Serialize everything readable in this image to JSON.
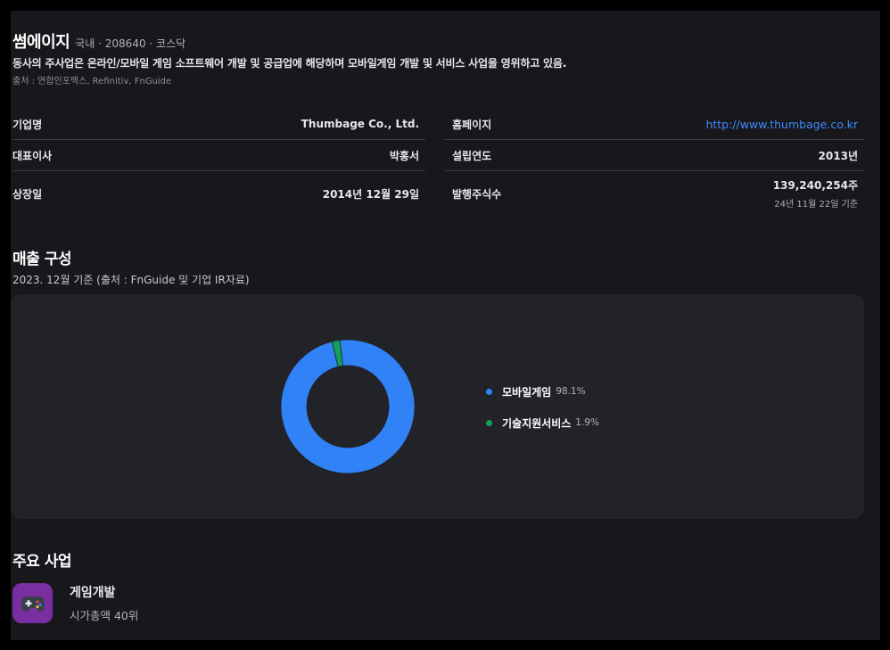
{
  "company": {
    "name": "썸에이지",
    "meta": "국내 · 208640 · 코스닥",
    "description": "동사의 주사업은 온라인/모바일 게임 소프트웨어 개발 및 공급업에 해당하며 모바일게임 개발 및 서비스 사업을 영위하고 있음.",
    "source": "출처 : 연합인포맥스, Refinitiv, FnGuide"
  },
  "info": {
    "left": [
      {
        "label": "기업명",
        "value": "Thumbage Co., Ltd."
      },
      {
        "label": "대표이사",
        "value": "박홍서"
      },
      {
        "label": "상장일",
        "value": "2014년 12월 29일"
      }
    ],
    "right": [
      {
        "label": "홈페이지",
        "value": "http://www.thumbage.co.kr"
      },
      {
        "label": "설립연도",
        "value": "2013년"
      },
      {
        "label": "발행주식수",
        "value": "139,240,254주",
        "sub": "24년 11월 22일 기준"
      }
    ]
  },
  "revenue": {
    "title": "매출 구성",
    "subtitle": "2023. 12월 기준 (출처 : FnGuide 및 기업 IR자료)"
  },
  "chart_data": {
    "type": "pie",
    "categories": [
      "모바일게임",
      "기술지원서비스"
    ],
    "values": [
      98.1,
      1.9
    ],
    "value_labels": [
      "98.1%",
      "1.9%"
    ],
    "colors": [
      "#3182f6",
      "#12a05c"
    ],
    "legend_placement": "right"
  },
  "business": {
    "title": "주요 사업",
    "items": [
      {
        "name": "게임개발",
        "rank": "시가총액 40위",
        "icon": "gamepad-icon",
        "icon_bg": "#7a2fa0"
      }
    ]
  }
}
